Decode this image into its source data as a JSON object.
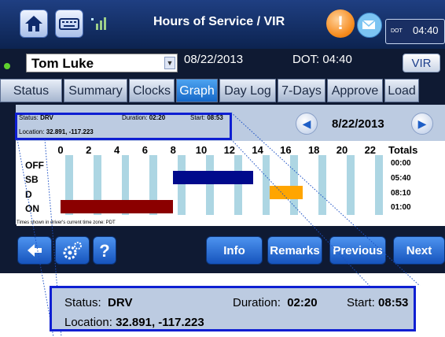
{
  "header": {
    "title": "Hours of Service / VIR",
    "home_icon": "home-icon",
    "keyboard_icon": "keyboard-icon",
    "signal_icon": "signal-icon",
    "alert_glyph": "!",
    "mail_icon": "mail-icon",
    "dot_clock_label": "DOT",
    "dot_clock_value": "04:40"
  },
  "driver_row": {
    "driver_name": "Tom Luke",
    "date": "08/22/2013",
    "dot": "DOT: 04:40",
    "vir_label": "VIR"
  },
  "tabs": [
    {
      "label": "Status"
    },
    {
      "label": "Summary"
    },
    {
      "label": "Clocks"
    },
    {
      "label": "Graph",
      "active": true
    },
    {
      "label": "Day Log"
    },
    {
      "label": "7-Days"
    },
    {
      "label": "Approve"
    },
    {
      "label": "Load"
    }
  ],
  "info": {
    "status_label": "Status:",
    "status_value": "DRV",
    "duration_label": "Duration:",
    "duration_value": "02:20",
    "start_label": "Start:",
    "start_value": "08:53",
    "location_label": "Location:",
    "location_value": "32.891, -117.223"
  },
  "date_nav": {
    "prev_glyph": "◀",
    "date": "8/22/2013",
    "next_glyph": "▶"
  },
  "graph": {
    "hours": [
      "0",
      "2",
      "4",
      "6",
      "8",
      "10",
      "12",
      "14",
      "16",
      "18",
      "20",
      "22"
    ],
    "totals_label": "Totals",
    "statuses": [
      {
        "label": "OFF",
        "total": "00:00",
        "color": "#ffffff",
        "segments": []
      },
      {
        "label": "SB",
        "total": "05:40",
        "color": "#000a8c",
        "segments": [
          [
            8.0,
            13.67
          ]
        ]
      },
      {
        "label": "D",
        "total": "08:10",
        "color": "#ffa500",
        "segments": [
          [
            14.87,
            17.2
          ]
        ]
      },
      {
        "label": "ON",
        "total": "01:00",
        "color": "#8b0000",
        "segments": [
          [
            0.0,
            8.0
          ]
        ]
      }
    ],
    "timezone_note": "Times shown in driver's current time zone:  PDT"
  },
  "buttons": {
    "back_icon": "back-arrow-icon",
    "settings_icon": "gears-icon",
    "help_label": "?",
    "info_label": "Info",
    "remarks_label": "Remarks",
    "previous_label": "Previous",
    "next_label": "Next"
  },
  "colors": {
    "accent": "#1668c8",
    "frame": "#0f1a33",
    "highlight_border": "#0e1fd2",
    "info_bg": "#bccbe1",
    "stripe": "#add6e3"
  }
}
